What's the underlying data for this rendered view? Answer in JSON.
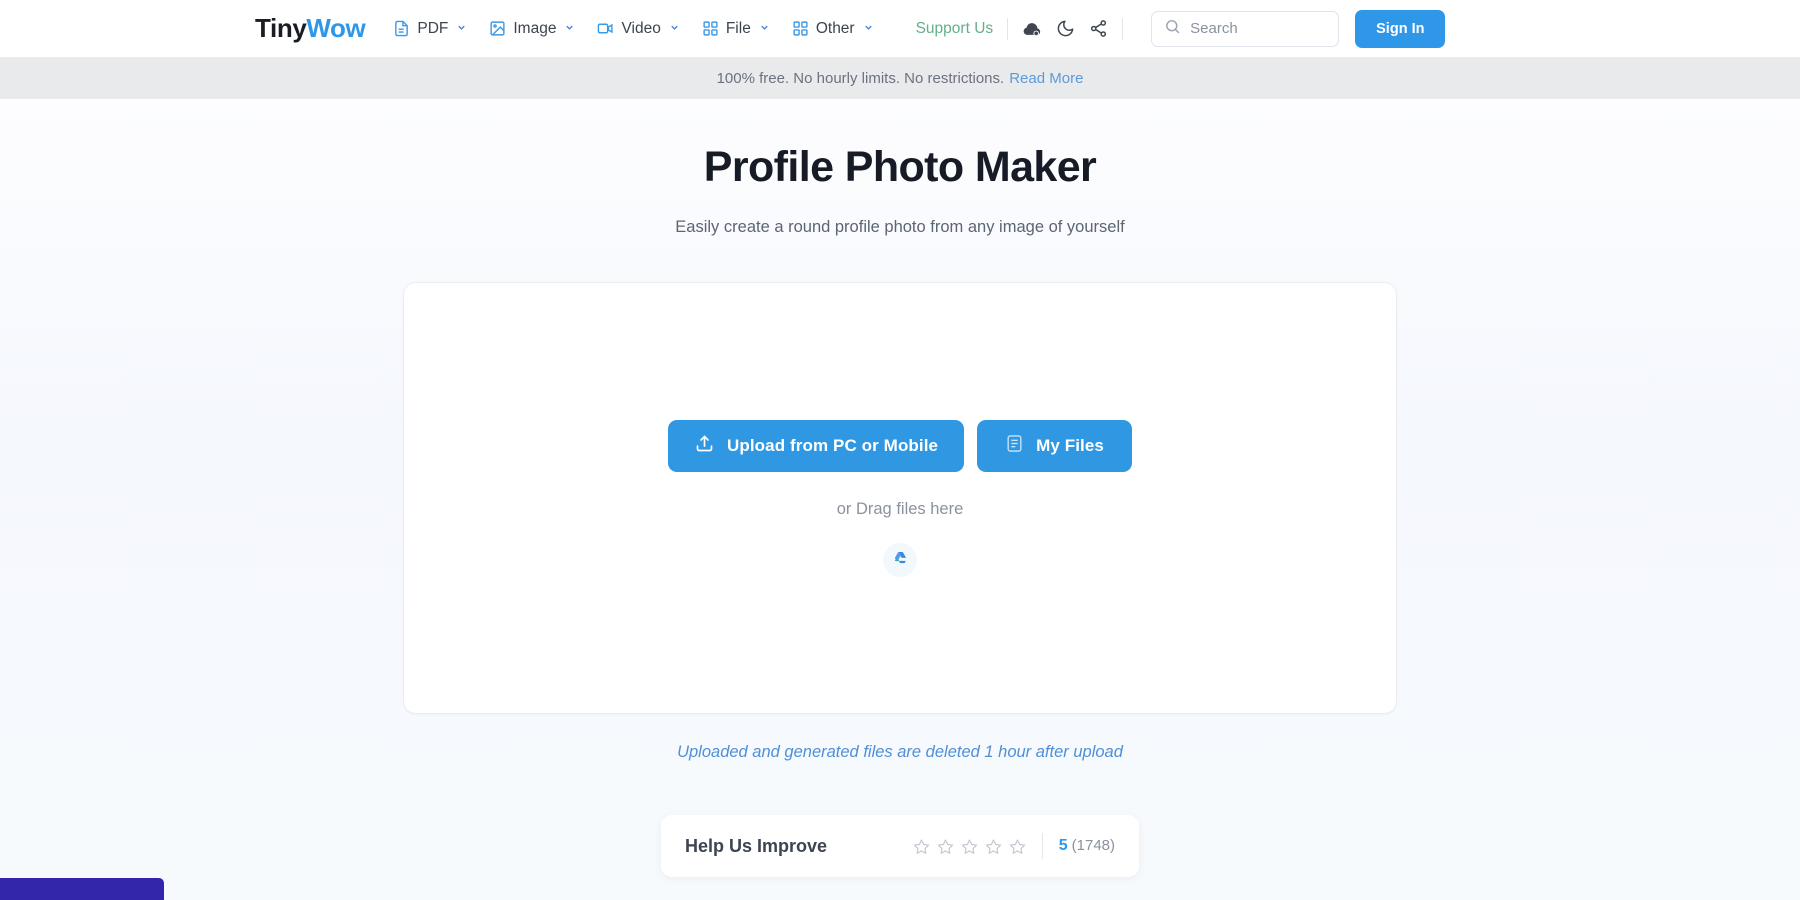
{
  "header": {
    "logo": {
      "first": "Tiny",
      "second": "Wow"
    },
    "nav": [
      {
        "label": "PDF",
        "icon": "pdf-file-icon",
        "caret": "⌄"
      },
      {
        "label": "Image",
        "icon": "image-icon",
        "caret": "⌄"
      },
      {
        "label": "Video",
        "icon": "video-camera-icon",
        "caret": "⌄"
      },
      {
        "label": "File",
        "icon": "grid-squares-icon",
        "caret": "⌄"
      },
      {
        "label": "Other",
        "icon": "grid-squares-icon",
        "caret": "⌄"
      }
    ],
    "support_label": "Support Us",
    "icons": [
      {
        "name": "cloud-dark-icon"
      },
      {
        "name": "moon-dark-mode-icon"
      },
      {
        "name": "share-icon"
      }
    ],
    "search": {
      "placeholder": "Search",
      "value": "",
      "icon": "search-icon"
    },
    "signin_label": "Sign In"
  },
  "notice": {
    "text": "100% free. No hourly limits. No restrictions.",
    "link": "Read More"
  },
  "page": {
    "title": "Profile Photo Maker",
    "subtitle": "Easily create a round profile photo from any image of yourself"
  },
  "dropzone": {
    "upload_button": "Upload from PC or Mobile",
    "upload_icon": "upload-arrow-icon",
    "myfiles_button": "My Files",
    "myfiles_icon": "document-list-icon",
    "drag_text": "or Drag files here",
    "drive_icon": "google-drive-icon"
  },
  "delete_note": "Uploaded and generated files are deleted 1 hour after upload",
  "rating": {
    "title": "Help Us Improve",
    "stars": [
      1,
      2,
      3,
      4,
      5
    ],
    "filled": 0,
    "score": "5",
    "count": "(1748)"
  },
  "colors": {
    "brand_blue": "#2f97e8",
    "logo_dark": "#1a1c24",
    "support_green": "#63b08a",
    "notice_bg": "#e8eaec",
    "link_blue": "#5b9bdc",
    "italic_blue": "#4f8fd8",
    "purple_bar": "#3326ab",
    "page_bg": "#f7f9fc"
  }
}
